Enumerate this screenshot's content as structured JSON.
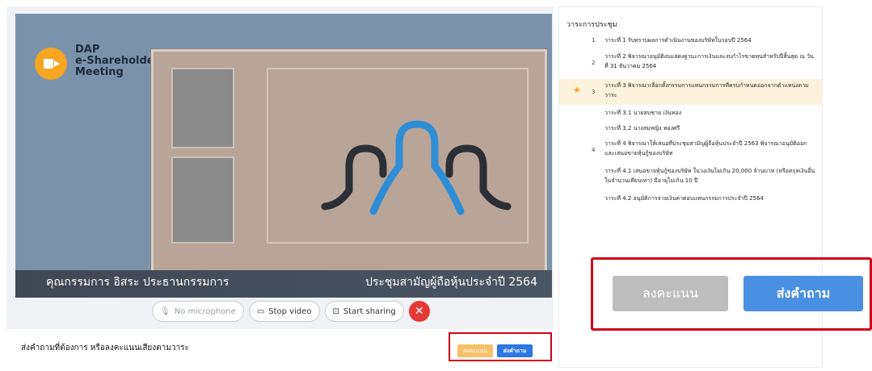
{
  "video": {
    "brand_line1": "DAP",
    "brand_line2": "e-Shareholder",
    "brand_line3": "Meeting",
    "caption_left": "คุณกรรมการ อิสระ ประธานกรรมการ",
    "caption_right": "ประชุมสามัญผู้ถือหุ้นประจำปี 2564"
  },
  "controls": {
    "microphone": "No microphone",
    "video": "Stop video",
    "sharing": "Start sharing"
  },
  "footer": {
    "text": "ส่งคำถามที่ต้องการ หรือลงคะแนนเสียงตามวาระ",
    "vote_label": "ลงคะแนน",
    "ask_label": "ส่งคำถาม"
  },
  "agenda": {
    "title": "วาระการประชุม",
    "items": [
      {
        "num": "1",
        "text": "วาระที่ 1 รับทราบผลการดำเนินงานของบริษัทในรอบปี 2564"
      },
      {
        "num": "2",
        "text": "วาระที่ 2 พิจารณาอนุมัติงบแสดงฐานะการเงินและงบกำไรขาดทุนสำหรับปีสิ้นสุด ณ วันที่ 31 ธันวาคม 2564"
      },
      {
        "num": "3",
        "text": "วาระที่ 3 พิจารณาเลือกตั้งกรรมการแทนกรรมการที่ครบกำหนดออกจากตำแหน่งตามวาระ"
      },
      {
        "num": "",
        "text": "วาระที่ 3.1 นายสมชาย เงินทอง"
      },
      {
        "num": "",
        "text": "วาระที่ 3.2 นางสมหญิง ทองศรี"
      },
      {
        "num": "4",
        "text": "วาระที่ 4 พิจารณาให้เสนอที่ประชุมสามัญผู้ถือหุ้นประจำปี 2563 พิจารณาอนุมัติออกและเสนอขายหุ้นกู้ของบริษัท"
      },
      {
        "num": "",
        "text": "วาระที่ 4.1 เสนอขายหุ้นกู้ของบริษัท ในวงเงินไม่เกิน 20,000 ล้านบาท (หรือสกุลเงินอื่นในจำนวนเทียบเท่า) มีอายุไม่เกิน 10 ปี"
      },
      {
        "num": "",
        "text": "วาระที่ 4.2 อนุมัติการจ่ายเงินค่าตอบแทนกรรมการประจำปี 2564"
      }
    ]
  },
  "zoom": {
    "vote_label": "ลงคะแนน",
    "ask_label": "ส่งคำถาม"
  },
  "colors": {
    "vote": "#f5c26b",
    "ask": "#2b78e4",
    "highlight": "#d0021b",
    "active_agenda": "#fdf2dc"
  }
}
